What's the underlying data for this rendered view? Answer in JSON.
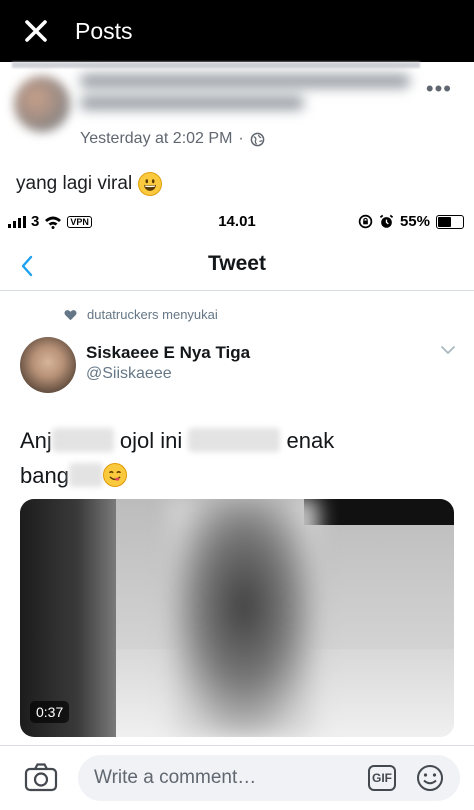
{
  "topbar": {
    "title": "Posts",
    "close_icon": "close-icon"
  },
  "post": {
    "timestamp": "Yesterday at 2:02 PM",
    "separator": "·",
    "text": "yang lagi viral",
    "more_label": "•••"
  },
  "embed": {
    "statusbar": {
      "carrier": "3",
      "vpn": "VPN",
      "time": "14.01",
      "battery": "55%",
      "battery_level": 0.55
    },
    "nav": {
      "title": "Tweet"
    },
    "liked_by": "dutatruckers menyukai",
    "tweet": {
      "name": "Siskaeee E Nya Tiga",
      "handle": "@Siiskaeee",
      "text_part1": "Anj",
      "text_part2": "ojol ini",
      "text_part3": "enak",
      "text_part4": "bang",
      "video_duration": "0:37"
    }
  },
  "commentbar": {
    "placeholder": "Write a comment…",
    "gif_label": "GIF"
  }
}
